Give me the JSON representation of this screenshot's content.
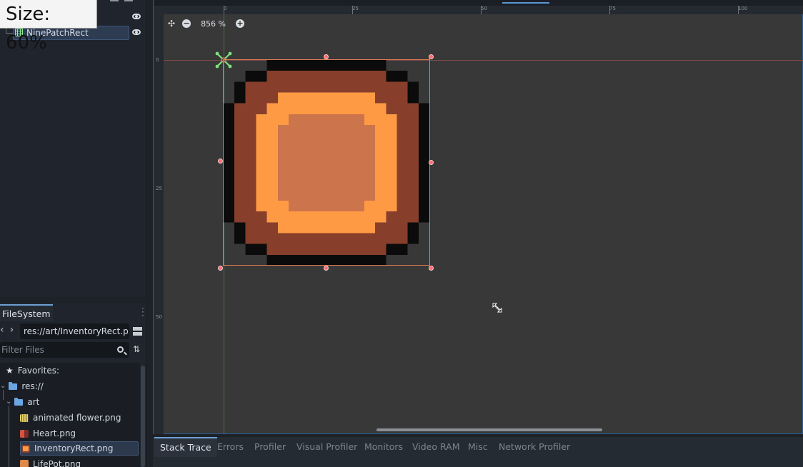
{
  "overlay": {
    "size_label": "Size: 60%"
  },
  "scene": {
    "node_label": "NinePatchRect",
    "icons": [
      "ninepatch-icon",
      "eye-icon"
    ]
  },
  "filesystem": {
    "tab_label": "FileSystem",
    "path_value": "res://art/InventoryRect.p",
    "filter_placeholder": "Filter Files",
    "favorites_label": "Favorites:",
    "root_label": "res://",
    "art_folder_label": "art",
    "files": [
      {
        "name": "animated flower.png",
        "icon": "animated-sprite-icon",
        "selected": false
      },
      {
        "name": "Heart.png",
        "icon": "image-icon",
        "selected": false
      },
      {
        "name": "InventoryRect.png",
        "icon": "image-icon",
        "selected": true
      },
      {
        "name": "LifePot.png",
        "icon": "image-icon",
        "selected": false
      }
    ]
  },
  "viewport": {
    "zoom_label": "856 %",
    "ruler_top_labels": [
      "0",
      "25",
      "50",
      "75",
      "100"
    ],
    "ruler_left_labels": [
      "0",
      "25",
      "50"
    ]
  },
  "bottom_panel": {
    "tabs": [
      "Stack Trace",
      "Errors",
      "Profiler",
      "Visual Profiler",
      "Monitors",
      "Video RAM",
      "Misc",
      "Network Profiler"
    ],
    "active_tab": "Stack Trace"
  },
  "colors": {
    "accent": "#6e9fd1",
    "selection": "#e07a55",
    "sprite_outline": "#0b0b0b",
    "sprite_brown": "#873f2c",
    "sprite_orange": "#ff9a44",
    "sprite_center": "#cc744c"
  }
}
